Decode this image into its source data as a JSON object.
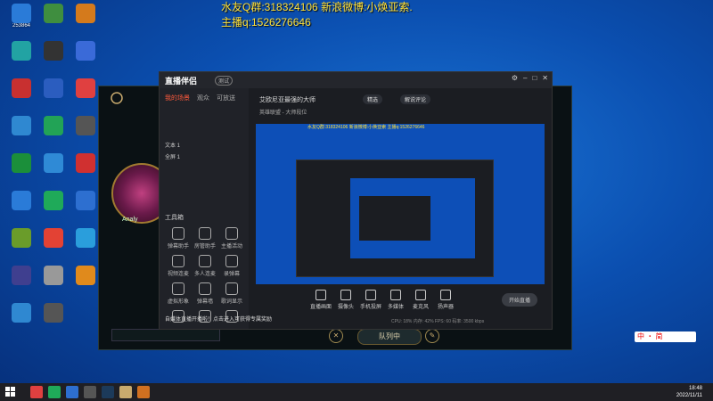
{
  "overlay": {
    "line1": "水友Q群:318324106 新浪微博:小焕亚索.",
    "line2": "主播q:1526276646"
  },
  "desktop_icons": [
    {
      "label": "253864",
      "color": "#2a7bd8"
    },
    {
      "label": "",
      "color": "#3f8e3f"
    },
    {
      "label": "",
      "color": "#d47a1c"
    },
    {
      "label": "",
      "color": "#22a3a3"
    },
    {
      "label": "",
      "color": "#333"
    },
    {
      "label": "",
      "color": "#3a6ad8"
    },
    {
      "label": "",
      "color": "#c83030"
    },
    {
      "label": "",
      "color": "#2b5dbf"
    },
    {
      "label": "",
      "color": "#e04040"
    },
    {
      "label": "",
      "color": "#2f88d1"
    },
    {
      "label": "",
      "color": "#22a356"
    },
    {
      "label": "",
      "color": "#555"
    },
    {
      "label": "",
      "color": "#1b8f3a"
    },
    {
      "label": "",
      "color": "#2f8ad6"
    },
    {
      "label": "",
      "color": "#d03030"
    },
    {
      "label": "",
      "color": "#2a7bd8"
    },
    {
      "label": "",
      "color": "#1faa59"
    },
    {
      "label": "",
      "color": "#2d6fd0"
    },
    {
      "label": "",
      "color": "#6a9c2a"
    },
    {
      "label": "",
      "color": "#e34234"
    },
    {
      "label": "",
      "color": "#2a9edc"
    },
    {
      "label": "",
      "color": "#3f3f8f"
    },
    {
      "label": "",
      "color": "#999"
    },
    {
      "label": "",
      "color": "#e08a1c"
    },
    {
      "label": "",
      "color": "#2f88d1"
    },
    {
      "label": "",
      "color": "#555"
    }
  ],
  "lol": {
    "name": "Analy",
    "queue_label": "队列中",
    "close_btn": "✕",
    "edit_btn": "✎"
  },
  "app": {
    "logo": "直播伴侣",
    "beta": "测试",
    "tabs": [
      "我的场景",
      "观众",
      "可放送"
    ],
    "scenes": [
      "",
      "",
      "",
      "文本 1",
      "全屏 1"
    ],
    "tools_title": "工具箱",
    "tools": [
      "弹幕助手",
      "房管助手",
      "主播活动",
      "视频连麦",
      "多人连麦",
      "录弹幕",
      "虚拟形象",
      "弹幕墙",
      "歌词显示",
      "",
      "",
      ""
    ],
    "notice": "自媒体直播开播啦！点击进入可获得专属奖励",
    "stream_title": "艾欧尼亚最强的大师",
    "pill1": "精选",
    "pill2": "解说评论",
    "meta": "英雄联盟 - 大师段位",
    "preview_text": "水友Q群:318324106 新浪微博:小焕亚索  主播q:1526276646",
    "bottom_buttons": [
      "直播画面",
      "摄像头",
      "手机投屏",
      "多媒体",
      "麦克风",
      "扬声器"
    ],
    "start_label": "开始直播",
    "stats": "CPU: 18%   内存: 42%   FPS: 60   码率: 3500 kbps"
  },
  "taskbar": {
    "time": "18:48",
    "date": "2022/11/11"
  },
  "input_method": "中 ・ 简"
}
